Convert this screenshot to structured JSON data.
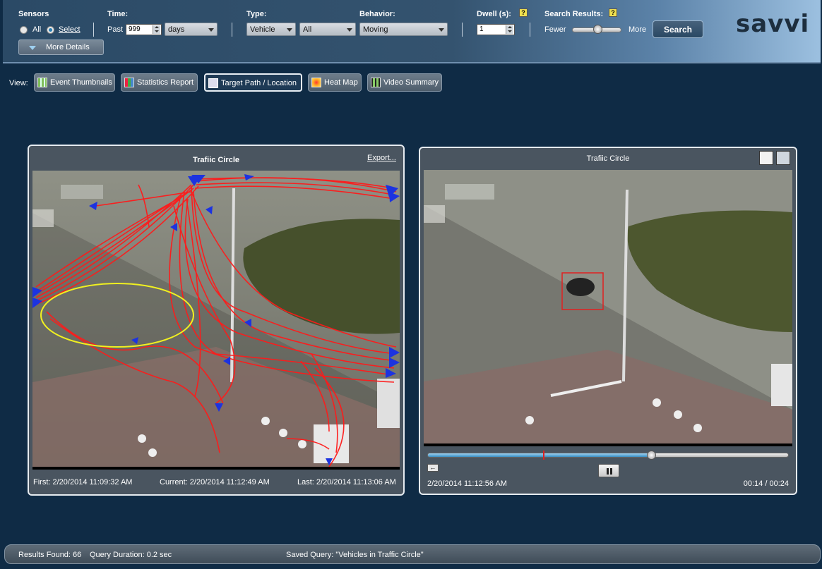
{
  "toolbar": {
    "sensors_label": "Sensors",
    "radio_all": "All",
    "radio_select": "Select",
    "more_details": "More Details",
    "time_label": "Time:",
    "past_label": "Past",
    "past_value": "999",
    "time_unit": "days",
    "type_label": "Type:",
    "type_value": "Vehicle",
    "type_sub": "All",
    "behavior_label": "Behavior:",
    "behavior_value": "Moving",
    "dwell_label": "Dwell (s):",
    "dwell_value": "1",
    "results_label": "Search Results:",
    "fewer": "Fewer",
    "more": "More",
    "search_button": "Search",
    "help_glyph": "?",
    "logo": "savvi",
    "slider_level": 0.55
  },
  "view": {
    "label": "View:",
    "buttons": [
      {
        "label": "Event Thumbnails"
      },
      {
        "label": "Statistics Report"
      },
      {
        "label": "Target Path / Location"
      },
      {
        "label": "Heat Map"
      },
      {
        "label": "Video Summary"
      }
    ]
  },
  "left_panel": {
    "title": "Trafiic Circle",
    "export": "Export...",
    "first": "First:  2/20/2014 11:09:32 AM",
    "current": "Current:  2/20/2014 11:12:49 AM",
    "last": "Last:  2/20/2014 11:13:06 AM"
  },
  "right_panel": {
    "title": "Trafiic Circle",
    "timestamp": "2/20/2014 11:12:56 AM",
    "elapsed": "00:14 / 00:24",
    "progress": 0.62
  },
  "status": {
    "results_found": "Results Found:  66",
    "query_duration": "Query Duration:   0.2 sec",
    "saved_query": "Saved Query: \"Vehicles in Traffic Circle\""
  },
  "colors": {
    "path": "#ff1a1a",
    "arrow": "#1c33e0",
    "zone": "#f0f020",
    "background": "#0f2b45"
  }
}
